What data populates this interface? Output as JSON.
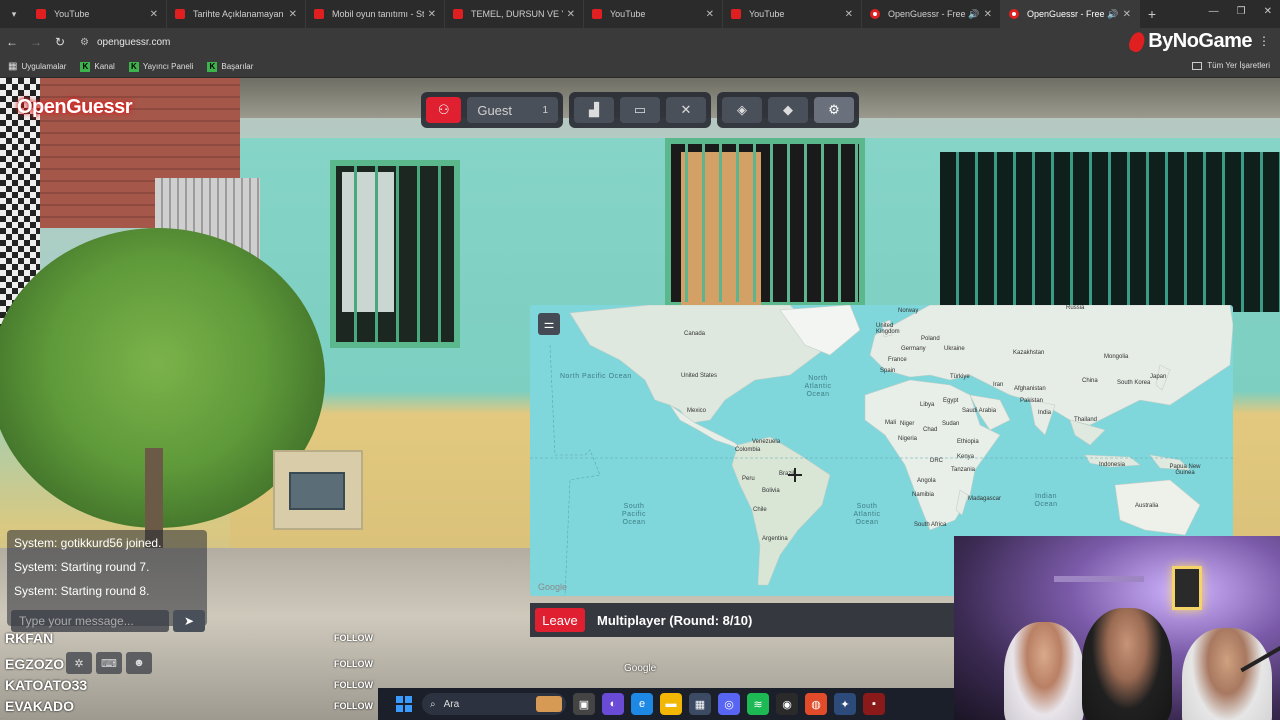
{
  "browser": {
    "tabs": [
      {
        "title": "YouTube",
        "favicon": "youtube",
        "active": false,
        "audio": false
      },
      {
        "title": "Tarihte Açıklanamayan Er",
        "favicon": "youtube",
        "active": false,
        "audio": false
      },
      {
        "title": "Mobil oyun tanıtımı - Sta",
        "favicon": "youtube",
        "active": false,
        "audio": false
      },
      {
        "title": "TEMEL, DURSUN VE YAM",
        "favicon": "youtube",
        "active": false,
        "audio": false
      },
      {
        "title": "YouTube",
        "favicon": "youtube",
        "active": false,
        "audio": false
      },
      {
        "title": "YouTube",
        "favicon": "youtube",
        "active": false,
        "audio": false
      },
      {
        "title": "OpenGuessr - Free G",
        "favicon": "openguessr",
        "active": false,
        "audio": true
      },
      {
        "title": "OpenGuessr - Free G",
        "favicon": "openguessr",
        "active": true,
        "audio": true
      }
    ],
    "url": "openguessr.com",
    "brand": "ByNoGame",
    "bookmarks": [
      {
        "label": "Uygulamalar",
        "icon": "apps-grid-icon"
      },
      {
        "label": "Kanal",
        "icon": "kick-icon"
      },
      {
        "label": "Yayıncı Paneli",
        "icon": "kick-icon"
      },
      {
        "label": "Başarılar",
        "icon": "kick-icon"
      }
    ],
    "all_bookmarks": "Tüm Yer İşaretleri"
  },
  "game": {
    "logo": "OpenGuessr",
    "player_name": "Guest",
    "player_count": "1",
    "map": {
      "countries": [
        "Russia",
        "Norway",
        "United Kingdom",
        "Poland",
        "Germany",
        "Ukraine",
        "Kazakhstan",
        "Mongolia",
        "France",
        "Spain",
        "Türkiye",
        "China",
        "South Korea",
        "Japan",
        "Iran",
        "Afghanistan",
        "Pakistan",
        "Libya",
        "Egypt",
        "Saudi Arabia",
        "India",
        "Mali",
        "Niger",
        "Chad",
        "Sudan",
        "Nigeria",
        "Ethiopia",
        "Thailand",
        "DRC",
        "Kenya",
        "Tanzania",
        "Indonesia",
        "Papua New Guinea",
        "Canada",
        "United States",
        "Mexico",
        "Venezuela",
        "Colombia",
        "Peru",
        "Brazil",
        "Bolivia",
        "Chile",
        "Argentina",
        "Angola",
        "Namibia",
        "Madagascar",
        "South Africa",
        "Australia"
      ],
      "oceans": [
        "North Pacific Ocean",
        "North Atlantic Ocean",
        "South Pacific Ocean",
        "South Atlantic Ocean",
        "Indian Ocean"
      ],
      "attribution": "Google"
    },
    "leave_label": "Leave",
    "status": "Multiplayer (Round: 8/10)",
    "street_attribution": "Google",
    "chat": {
      "messages": [
        "System: gotikkurd56 joined.",
        "System: Starting round 7.",
        "System: Starting round 8."
      ],
      "placeholder": "Type your message..."
    }
  },
  "stream": {
    "follows": [
      {
        "name": "RKFAN",
        "action": "FOLLOW"
      },
      {
        "name": "EGZOZO",
        "action": "FOLLOW"
      },
      {
        "name": "KATOATO33",
        "action": "FOLLOW"
      },
      {
        "name": "EVAKADO",
        "action": "FOLLOW"
      }
    ]
  },
  "taskbar": {
    "search_placeholder": "Ara"
  },
  "colors": {
    "accent_red": "#e02030",
    "panel": "#282c34",
    "map_water": "#7fd6db",
    "map_land": "#e6ebe6"
  }
}
